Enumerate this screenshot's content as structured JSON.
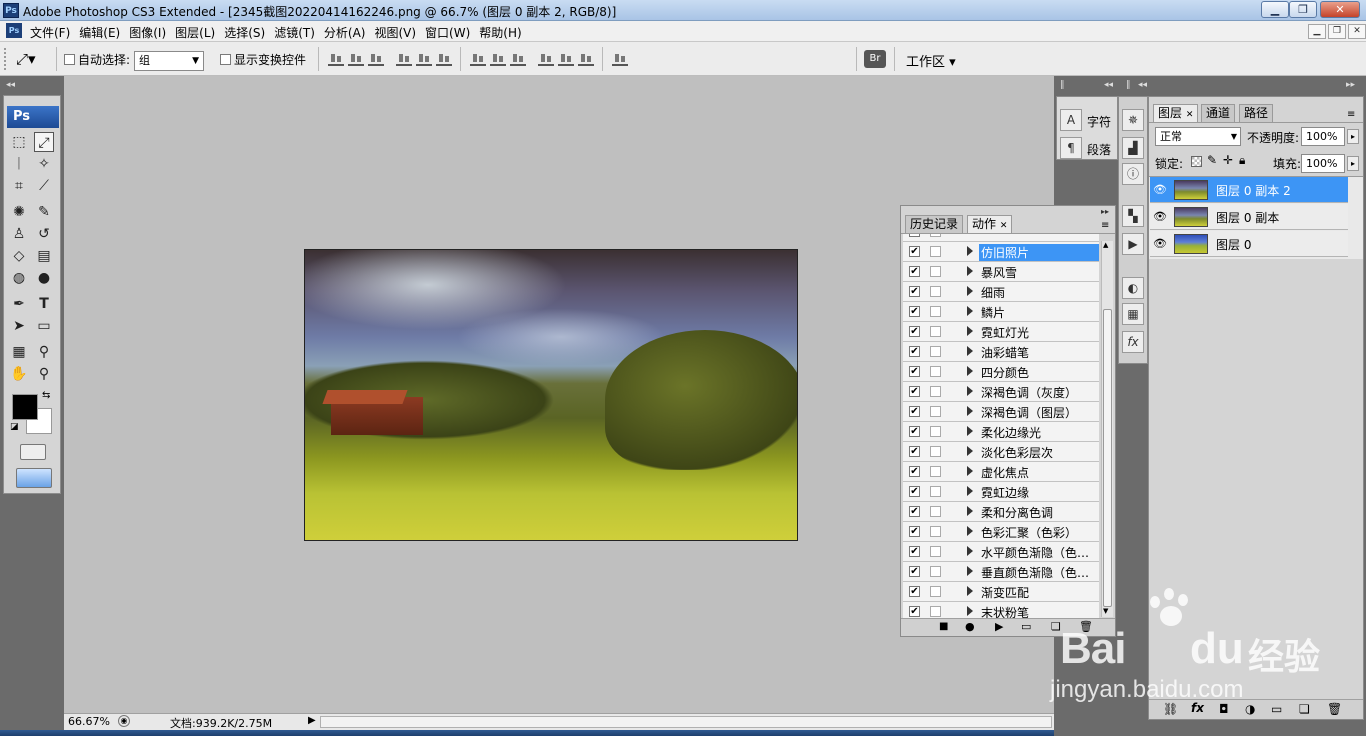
{
  "window": {
    "app_icon": "Ps",
    "title": "Adobe Photoshop CS3 Extended - [2345截图20220414162246.png @ 66.7% (图层 0 副本 2, RGB/8)]",
    "minimize_icon": "minimize-icon",
    "maximize_icon": "maximize-icon",
    "close_icon": "close-icon"
  },
  "menu": {
    "items": [
      "文件(F)",
      "编辑(E)",
      "图像(I)",
      "图层(L)",
      "选择(S)",
      "滤镜(T)",
      "分析(A)",
      "视图(V)",
      "窗口(W)",
      "帮助(H)"
    ]
  },
  "options": {
    "auto_select_label": "自动选择:",
    "auto_select_value": "组",
    "show_transform_label": "显示变换控件",
    "workspace_label": "工作区 ▾"
  },
  "toolbox": {
    "logo": "Ps"
  },
  "status": {
    "zoom": "66.67%",
    "doc_info": "文档:939.2K/2.75M"
  },
  "char_panel": {
    "char_label": "字符",
    "para_label": "段落"
  },
  "layers_panel": {
    "tabs": [
      "图层",
      "通道",
      "路径"
    ],
    "blend_mode": "正常",
    "opacity_label": "不透明度:",
    "opacity_value": "100%",
    "lock_label": "锁定:",
    "fill_label": "填充:",
    "fill_value": "100%",
    "layers": [
      {
        "name": "图层 0 副本 2",
        "selected": true
      },
      {
        "name": "图层 0 副本",
        "selected": false
      },
      {
        "name": "图层 0",
        "selected": false
      }
    ]
  },
  "actions_panel": {
    "tabs": [
      "历史记录",
      "动作"
    ],
    "items": [
      "仿旧照片",
      "暴风雪",
      "细雨",
      "鳞片",
      "霓虹灯光",
      "油彩蜡笔",
      "四分颜色",
      "深褐色调（灰度）",
      "深褐色调（图层）",
      "柔化边缘光",
      "淡化色彩层次",
      "虚化焦点",
      "霓虹边缘",
      "柔和分离色调",
      "色彩汇聚（色彩）",
      "水平颜色渐隐（色…",
      "垂直颜色渐隐（色…",
      "渐变匹配",
      "末状粉笔"
    ],
    "selected_index": 0
  },
  "watermark": {
    "brand": "Bai",
    "brand2": "du",
    "product": "经验",
    "url": "jingyan.baidu.com"
  },
  "colors": {
    "accent": "#3d95f5",
    "workspace": "#bfbfbf",
    "panel": "#d4d4d4"
  }
}
